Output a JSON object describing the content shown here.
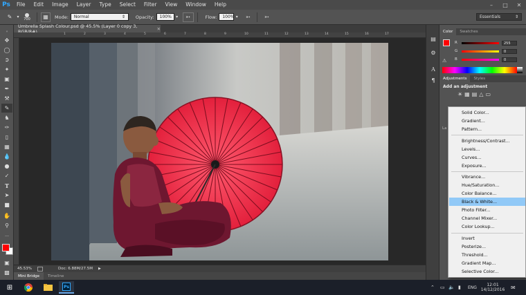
{
  "app": {
    "logo": "Ps"
  },
  "menubar": {
    "items": [
      "File",
      "Edit",
      "Image",
      "Layer",
      "Type",
      "Select",
      "Filter",
      "View",
      "Window",
      "Help"
    ]
  },
  "window_controls": {
    "minimize": "minimize-icon",
    "maximize": "maximize-icon",
    "close": "close-icon"
  },
  "options": {
    "brush_size": "700",
    "mode_label": "Mode:",
    "mode_value": "Normal",
    "opacity_label": "Opacity:",
    "opacity_value": "100%",
    "flow_label": "Flow:",
    "flow_value": "100%",
    "workspace": "Essentials"
  },
  "document": {
    "tab_title": "Umbrella Splash Colour.psd @ 45.5% (Layer 0 copy 3, RGB/8#)",
    "ruler_marks": [
      "1",
      "2",
      "3",
      "4",
      "5",
      "6",
      "7",
      "8",
      "9",
      "10",
      "11",
      "12",
      "13",
      "14",
      "15",
      "16",
      "17"
    ]
  },
  "status": {
    "zoom": "45.53%",
    "doc_size": "Doc: 6.88M/27.5M"
  },
  "bottom_tabs": [
    "Mini Bridge",
    "Timeline"
  ],
  "panels": {
    "color_tabs": [
      "Color",
      "Swatches"
    ],
    "channels": [
      {
        "label": "R",
        "value": "255"
      },
      {
        "label": "G",
        "value": "0"
      },
      {
        "label": "B",
        "value": "0"
      }
    ],
    "adjustment_tabs": [
      "Adjustments",
      "Styles"
    ],
    "add_adjustment": "Add an adjustment",
    "layers_tab_stub": "La"
  },
  "adjustment_menu": {
    "items": [
      "Solid Color...",
      "Gradient...",
      "Pattern...",
      "Brightness/Contrast...",
      "Levels...",
      "Curves...",
      "Exposure...",
      "Vibrance...",
      "Hue/Saturation...",
      "Color Balance...",
      "Black & White...",
      "Photo Filter...",
      "Channel Mixer...",
      "Color Lookup...",
      "Invert",
      "Posterize...",
      "Threshold...",
      "Gradient Map...",
      "Selective Color..."
    ],
    "highlighted": "Black & White..."
  },
  "taskbar": {
    "lang": "ENG",
    "time": "12:01",
    "date": "14/12/2016"
  },
  "colors": {
    "foreground": "#ff0000",
    "background": "#ffffff",
    "menu_highlight": "#91c9f7"
  }
}
